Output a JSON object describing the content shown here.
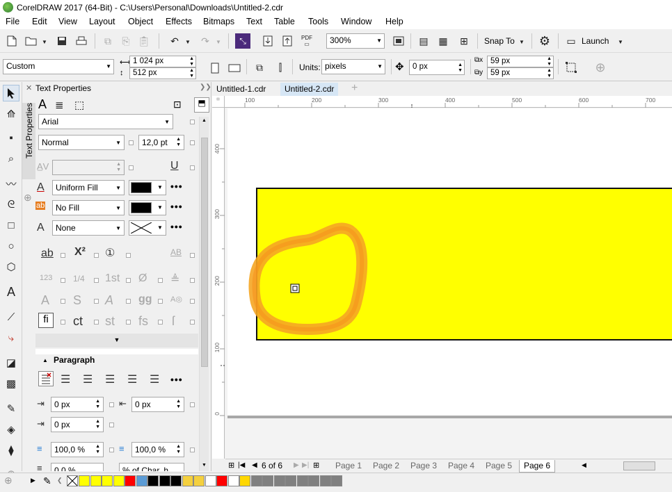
{
  "window": {
    "title": "CorelDRAW 2017 (64-Bit) - C:\\Users\\Personal\\Downloads\\Untitled-2.cdr"
  },
  "menu": [
    "File",
    "Edit",
    "View",
    "Layout",
    "Object",
    "Effects",
    "Bitmaps",
    "Text",
    "Table",
    "Tools",
    "Window",
    "Help"
  ],
  "toolbar": {
    "zoom": "300%",
    "snap_to": "Snap To",
    "launch": "Launch",
    "pdf": "PDF"
  },
  "property_bar": {
    "page_size": "Custom",
    "width": "1 024 px",
    "height": "512 px",
    "units_label": "Units:",
    "units": "pixels",
    "nudge": "0 px",
    "dup_x": "59 px",
    "dup_y": "59 px"
  },
  "docker": {
    "title": "Text Properties",
    "vertical_tab": "Text Properties",
    "font": "Arial",
    "style": "Normal",
    "size": "12,0 pt",
    "fill1": "Uniform Fill",
    "fill2": "No Fill",
    "outline": "None",
    "paragraph_title": "Paragraph",
    "indent_left": "0 px",
    "indent_first": "0 px",
    "indent_right": "0 px",
    "spacing_before": "100,0 %",
    "spacing_after": "100,0 %",
    "line_spacing": "0,0 %",
    "line_spacing_unit": "% of Char. h..."
  },
  "tabs": [
    "Untitled-1.cdr",
    "Untitled-2.cdr"
  ],
  "ruler_h": [
    "100",
    "200",
    "300",
    "400",
    "500",
    "600",
    "700"
  ],
  "ruler_v": [
    "400",
    "300",
    "200",
    "100",
    "0"
  ],
  "page_nav": {
    "of_label": "6 of 6",
    "pages": [
      "Page 1",
      "Page 2",
      "Page 3",
      "Page 4",
      "Page 5",
      "Page 6"
    ]
  },
  "palette": [
    "#ffff00",
    "#ffff00",
    "#ffff00",
    "#ffff00",
    "#ff0000",
    "#5b9bd5",
    "#000000",
    "#000000",
    "#000000",
    "#f4d03f",
    "#f4d03f",
    "#ffffff",
    "#ff0000",
    "#ffffff",
    "#ffd700",
    "#808080",
    "#808080",
    "#808080",
    "#808080",
    "#808080",
    "#808080",
    "#808080",
    "#808080"
  ],
  "colors": {
    "rect_fill": "#ffff00",
    "stroke": "#f5a623",
    "accent_tab": "#d6e6f5"
  }
}
